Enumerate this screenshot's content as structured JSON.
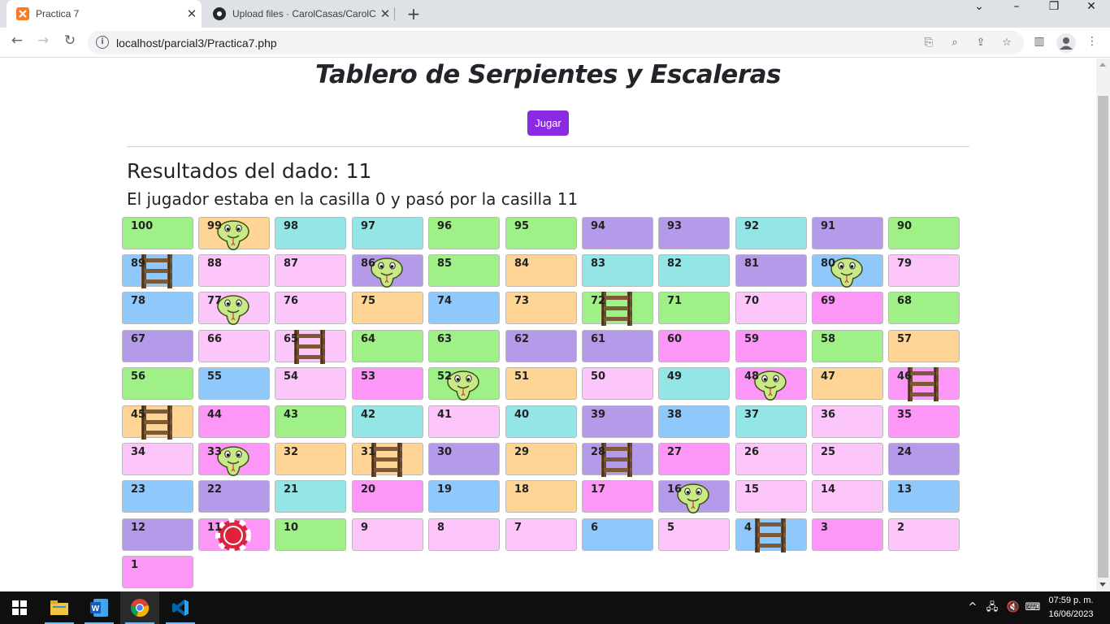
{
  "browser": {
    "tabs": [
      {
        "title": "Practica 7",
        "active": true,
        "favicon": "xampp-icon"
      },
      {
        "title": "Upload files · CarolCasas/CarolCa",
        "active": false,
        "favicon": "github-icon"
      }
    ],
    "url": "localhost/parcial3/Practica7.php"
  },
  "page": {
    "title": "Tablero de Serpientes y Escaleras",
    "play_button": "Jugar",
    "result": "Resultados del dado: 11",
    "status": "El jugador estaba en la casilla 0 y pasó por la casilla 11"
  },
  "board": {
    "palette": {
      "green": "#9ef087",
      "orange": "#fed594",
      "teal": "#94e5e5",
      "purple": "#b69aea",
      "pink": "#fcc6fb",
      "magenta": "#fc97f8",
      "blue": "#8fc9fb"
    },
    "rows": [
      [
        {
          "n": "100",
          "c": "green"
        },
        {
          "n": "99",
          "c": "orange",
          "i": "snake"
        },
        {
          "n": "98",
          "c": "teal"
        },
        {
          "n": "97",
          "c": "teal"
        },
        {
          "n": "96",
          "c": "green"
        },
        {
          "n": "95",
          "c": "green"
        },
        {
          "n": "94",
          "c": "purple"
        },
        {
          "n": "93",
          "c": "purple"
        },
        {
          "n": "92",
          "c": "teal"
        },
        {
          "n": "91",
          "c": "purple"
        },
        {
          "n": "90",
          "c": "green"
        }
      ],
      [
        {
          "n": "89",
          "c": "blue",
          "i": "ladder"
        },
        {
          "n": "88",
          "c": "pink"
        },
        {
          "n": "87",
          "c": "pink"
        },
        {
          "n": "86",
          "c": "purple",
          "i": "snake"
        },
        {
          "n": "85",
          "c": "green"
        },
        {
          "n": "84",
          "c": "orange"
        },
        {
          "n": "83",
          "c": "teal"
        },
        {
          "n": "82",
          "c": "teal"
        },
        {
          "n": "81",
          "c": "purple"
        },
        {
          "n": "80",
          "c": "blue",
          "i": "snake"
        },
        {
          "n": "79",
          "c": "pink"
        }
      ],
      [
        {
          "n": "78",
          "c": "blue"
        },
        {
          "n": "77",
          "c": "pink",
          "i": "snake"
        },
        {
          "n": "76",
          "c": "pink"
        },
        {
          "n": "75",
          "c": "orange"
        },
        {
          "n": "74",
          "c": "blue"
        },
        {
          "n": "73",
          "c": "orange"
        },
        {
          "n": "72",
          "c": "green",
          "i": "ladder"
        },
        {
          "n": "71",
          "c": "green"
        },
        {
          "n": "70",
          "c": "pink"
        },
        {
          "n": "69",
          "c": "magenta"
        },
        {
          "n": "68",
          "c": "green"
        }
      ],
      [
        {
          "n": "67",
          "c": "purple"
        },
        {
          "n": "66",
          "c": "pink"
        },
        {
          "n": "65",
          "c": "pink",
          "i": "ladder"
        },
        {
          "n": "64",
          "c": "green"
        },
        {
          "n": "63",
          "c": "green"
        },
        {
          "n": "62",
          "c": "purple"
        },
        {
          "n": "61",
          "c": "purple"
        },
        {
          "n": "60",
          "c": "magenta"
        },
        {
          "n": "59",
          "c": "magenta"
        },
        {
          "n": "58",
          "c": "green"
        },
        {
          "n": "57",
          "c": "orange"
        }
      ],
      [
        {
          "n": "56",
          "c": "green"
        },
        {
          "n": "55",
          "c": "blue"
        },
        {
          "n": "54",
          "c": "pink"
        },
        {
          "n": "53",
          "c": "magenta"
        },
        {
          "n": "52",
          "c": "green",
          "i": "snake"
        },
        {
          "n": "51",
          "c": "orange"
        },
        {
          "n": "50",
          "c": "pink"
        },
        {
          "n": "49",
          "c": "teal"
        },
        {
          "n": "48",
          "c": "magenta",
          "i": "snake"
        },
        {
          "n": "47",
          "c": "orange"
        },
        {
          "n": "46",
          "c": "magenta",
          "i": "ladder"
        }
      ],
      [
        {
          "n": "45",
          "c": "orange",
          "i": "ladder"
        },
        {
          "n": "44",
          "c": "magenta"
        },
        {
          "n": "43",
          "c": "green"
        },
        {
          "n": "42",
          "c": "teal"
        },
        {
          "n": "41",
          "c": "pink"
        },
        {
          "n": "40",
          "c": "teal"
        },
        {
          "n": "39",
          "c": "purple"
        },
        {
          "n": "38",
          "c": "blue"
        },
        {
          "n": "37",
          "c": "teal"
        },
        {
          "n": "36",
          "c": "pink"
        },
        {
          "n": "35",
          "c": "magenta"
        }
      ],
      [
        {
          "n": "34",
          "c": "pink"
        },
        {
          "n": "33",
          "c": "magenta",
          "i": "snake"
        },
        {
          "n": "32",
          "c": "orange"
        },
        {
          "n": "31",
          "c": "orange",
          "i": "ladder"
        },
        {
          "n": "30",
          "c": "purple"
        },
        {
          "n": "29",
          "c": "orange"
        },
        {
          "n": "28",
          "c": "purple",
          "i": "ladder"
        },
        {
          "n": "27",
          "c": "magenta"
        },
        {
          "n": "26",
          "c": "pink"
        },
        {
          "n": "25",
          "c": "pink"
        },
        {
          "n": "24",
          "c": "purple"
        }
      ],
      [
        {
          "n": "23",
          "c": "blue"
        },
        {
          "n": "22",
          "c": "purple"
        },
        {
          "n": "21",
          "c": "teal"
        },
        {
          "n": "20",
          "c": "magenta"
        },
        {
          "n": "19",
          "c": "blue"
        },
        {
          "n": "18",
          "c": "orange"
        },
        {
          "n": "17",
          "c": "magenta"
        },
        {
          "n": "16",
          "c": "purple",
          "i": "snake"
        },
        {
          "n": "15",
          "c": "pink"
        },
        {
          "n": "14",
          "c": "pink"
        },
        {
          "n": "13",
          "c": "blue"
        }
      ],
      [
        {
          "n": "12",
          "c": "purple"
        },
        {
          "n": "11",
          "c": "magenta",
          "i": "chip"
        },
        {
          "n": "10",
          "c": "green"
        },
        {
          "n": "9",
          "c": "pink"
        },
        {
          "n": "8",
          "c": "pink"
        },
        {
          "n": "7",
          "c": "pink"
        },
        {
          "n": "6",
          "c": "blue"
        },
        {
          "n": "5",
          "c": "pink"
        },
        {
          "n": "4",
          "c": "blue",
          "i": "ladder"
        },
        {
          "n": "3",
          "c": "magenta"
        },
        {
          "n": "2",
          "c": "pink"
        }
      ],
      [
        {
          "n": "1",
          "c": "magenta"
        }
      ]
    ]
  },
  "taskbar": {
    "apps": [
      "file-explorer-icon",
      "word-icon",
      "chrome-icon",
      "vscode-icon"
    ],
    "time": "07:59 p. m.",
    "date": "16/06/2023"
  }
}
